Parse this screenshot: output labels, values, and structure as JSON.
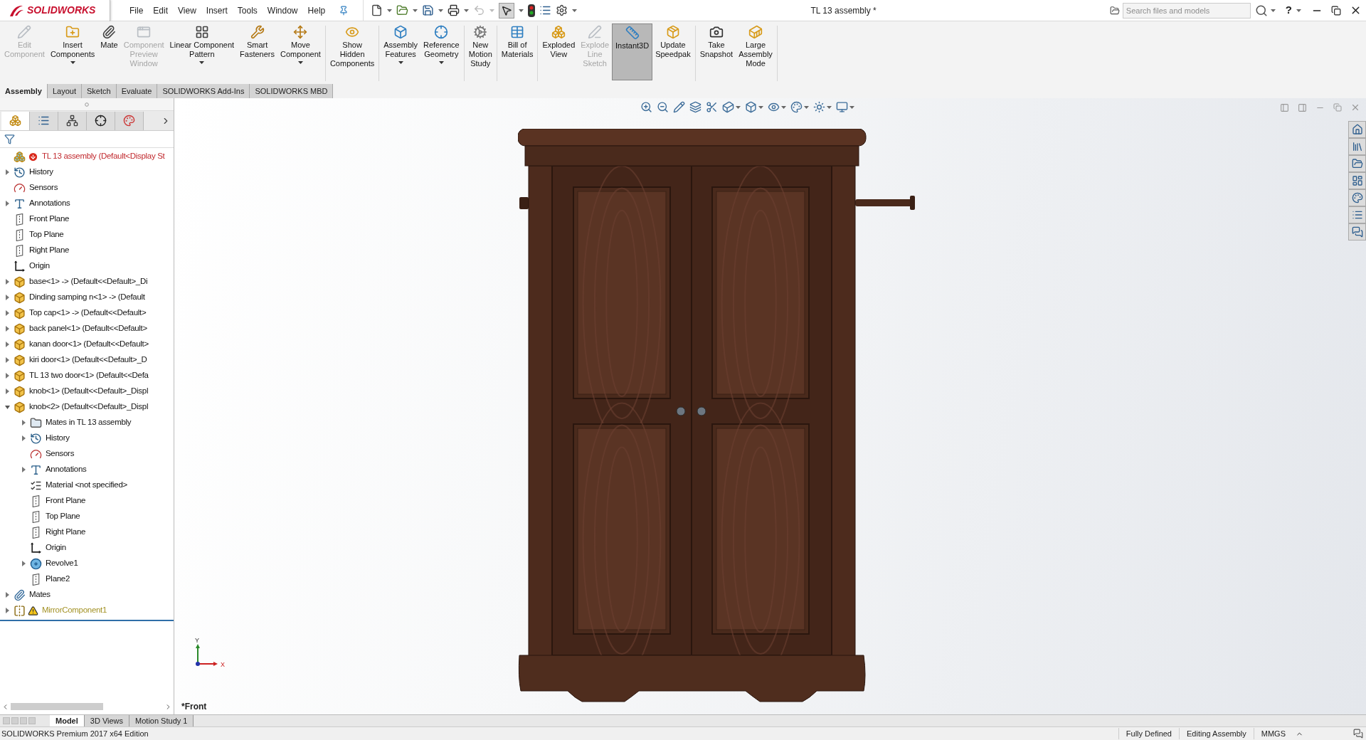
{
  "title_bar": {
    "logo": "SOLIDWORKS",
    "menu": [
      "File",
      "Edit",
      "View",
      "Insert",
      "Tools",
      "Window",
      "Help"
    ],
    "title": "TL 13 assembly *",
    "search": {
      "placeholder": "Search files and models"
    },
    "help": "?"
  },
  "ribbon": {
    "groups": [
      {
        "buttons": [
          {
            "label": "Edit\nComponent",
            "disabled": true,
            "dropdown": false,
            "on": false
          },
          {
            "label": "Insert\nComponents",
            "disabled": false,
            "dropdown": true,
            "on": false
          },
          {
            "label": "Mate",
            "disabled": false,
            "dropdown": false,
            "on": false
          },
          {
            "label": "Component\nPreview\nWindow",
            "disabled": true,
            "dropdown": false,
            "on": false
          },
          {
            "label": "Linear Component\nPattern",
            "disabled": false,
            "dropdown": true,
            "on": false
          },
          {
            "label": "Smart\nFasteners",
            "disabled": false,
            "dropdown": false,
            "on": false
          },
          {
            "label": "Move\nComponent",
            "disabled": false,
            "dropdown": true,
            "on": false
          }
        ]
      },
      {
        "buttons": [
          {
            "label": "Show\nHidden\nComponents",
            "disabled": false,
            "dropdown": false,
            "on": false
          }
        ]
      },
      {
        "buttons": [
          {
            "label": "Assembly\nFeatures",
            "disabled": false,
            "dropdown": true,
            "on": false
          },
          {
            "label": "Reference\nGeometry",
            "disabled": false,
            "dropdown": true,
            "on": false
          }
        ]
      },
      {
        "buttons": [
          {
            "label": "New\nMotion\nStudy",
            "disabled": false,
            "dropdown": false,
            "on": false
          }
        ]
      },
      {
        "buttons": [
          {
            "label": "Bill of\nMaterials",
            "disabled": false,
            "dropdown": false,
            "on": false
          }
        ]
      },
      {
        "buttons": [
          {
            "label": "Exploded\nView",
            "disabled": false,
            "dropdown": false,
            "on": false
          },
          {
            "label": "Explode\nLine\nSketch",
            "disabled": true,
            "dropdown": false,
            "on": false
          },
          {
            "label": "Instant3D",
            "disabled": false,
            "dropdown": false,
            "on": true
          },
          {
            "label": "Update\nSpeedpak",
            "disabled": false,
            "dropdown": false,
            "on": false
          }
        ]
      },
      {
        "buttons": [
          {
            "label": "Take\nSnapshot",
            "disabled": false,
            "dropdown": false,
            "on": false
          },
          {
            "label": "Large\nAssembly\nMode",
            "disabled": false,
            "dropdown": false,
            "on": false
          }
        ]
      }
    ]
  },
  "command_tabs": [
    {
      "label": "Assembly",
      "selected": true
    },
    {
      "label": "Layout",
      "selected": false
    },
    {
      "label": "Sketch",
      "selected": false
    },
    {
      "label": "Evaluate",
      "selected": false
    },
    {
      "label": "SOLIDWORKS Add-Ins",
      "selected": false
    },
    {
      "label": "SOLIDWORKS MBD",
      "selected": false
    }
  ],
  "panel_tabs": [
    {
      "selected": true
    },
    {
      "selected": false
    },
    {
      "selected": false
    },
    {
      "selected": false
    },
    {
      "selected": false
    }
  ],
  "tree": [
    {
      "label": "TL 13 assembly  (Default<Display St",
      "kind": "assembly"
    },
    {
      "label": "History",
      "kind": "history",
      "expanded": false
    },
    {
      "label": "Sensors",
      "kind": "sensors"
    },
    {
      "label": "Annotations",
      "kind": "annotations",
      "expanded": false
    },
    {
      "label": "Front Plane",
      "kind": "plane"
    },
    {
      "label": "Top Plane",
      "kind": "plane"
    },
    {
      "label": "Right Plane",
      "kind": "plane"
    },
    {
      "label": "Origin",
      "kind": "origin"
    },
    {
      "label": "base<1> -> (Default<<Default>_Di",
      "kind": "part",
      "expanded": false
    },
    {
      "label": "Dinding samping n<1> -> (Default",
      "kind": "part",
      "expanded": false
    },
    {
      "label": "Top cap<1> -> (Default<<Default>",
      "kind": "part",
      "expanded": false
    },
    {
      "label": "back panel<1> (Default<<Default>",
      "kind": "part",
      "expanded": false
    },
    {
      "label": "kanan door<1> (Default<<Default>",
      "kind": "part",
      "expanded": false
    },
    {
      "label": "kiri door<1> (Default<<Default>_D",
      "kind": "part",
      "expanded": false
    },
    {
      "label": "TL 13 two door<1> (Default<<Defa",
      "kind": "part",
      "expanded": false
    },
    {
      "label": "knob<1> (Default<<Default>_Displ",
      "kind": "part",
      "expanded": false
    },
    {
      "label": "knob<2> (Default<<Default>_Displ",
      "kind": "part",
      "expanded": true,
      "children": [
        {
          "label": "Mates in TL 13 assembly",
          "kind": "mates-folder",
          "expanded": false
        },
        {
          "label": "History",
          "kind": "history",
          "expanded": false
        },
        {
          "label": "Sensors",
          "kind": "sensors"
        },
        {
          "label": "Annotations",
          "kind": "annotations",
          "expanded": false
        },
        {
          "label": "Material <not specified>",
          "kind": "material"
        },
        {
          "label": "Front Plane",
          "kind": "plane"
        },
        {
          "label": "Top Plane",
          "kind": "plane"
        },
        {
          "label": "Right Plane",
          "kind": "plane"
        },
        {
          "label": "Origin",
          "kind": "origin"
        },
        {
          "label": "Revolve1",
          "kind": "revolve",
          "expanded": false
        },
        {
          "label": "Plane2",
          "kind": "plane"
        }
      ]
    },
    {
      "label": "Mates",
      "kind": "mates",
      "expanded": false
    },
    {
      "label": "MirrorComponent1",
      "kind": "mirror",
      "expanded": false
    }
  ],
  "viewport": {
    "view_name": "*Front",
    "triad": {
      "y": "Y",
      "x": "X"
    }
  },
  "bottom_tabs": [
    {
      "label": "Model",
      "selected": true
    },
    {
      "label": "3D Views",
      "selected": false
    },
    {
      "label": "Motion Study 1",
      "selected": false
    }
  ],
  "status_bar": {
    "edition": "SOLIDWORKS Premium 2017 x64 Edition",
    "items": [
      "Fully Defined",
      "Editing Assembly",
      "MMGS"
    ]
  }
}
